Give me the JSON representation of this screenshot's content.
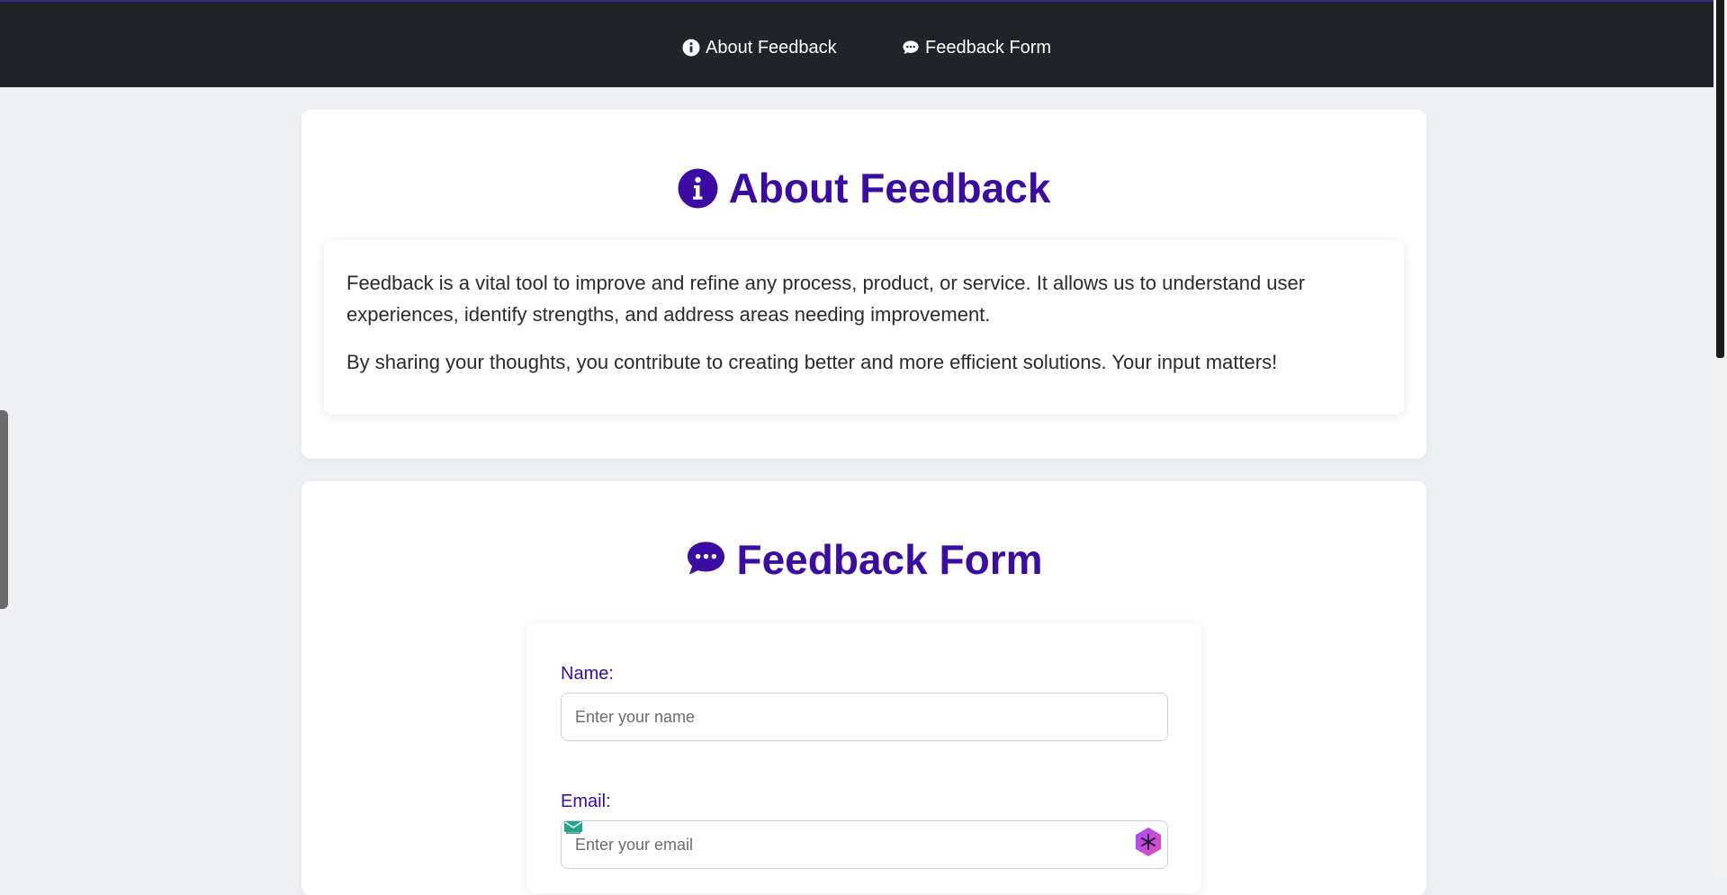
{
  "nav": {
    "about_label": "About Feedback",
    "form_label": "Feedback Form"
  },
  "about": {
    "title": "About Feedback",
    "paragraph1": "Feedback is a vital tool to improve and refine any process, product, or service. It allows us to understand user experiences, identify strengths, and address areas needing improvement.",
    "paragraph2": "By sharing your thoughts, you contribute to creating better and more efficient solutions. Your input matters!"
  },
  "form": {
    "title": "Feedback Form",
    "name_label": "Name:",
    "name_placeholder": "Enter your name",
    "name_value": "",
    "email_label": "Email:",
    "email_placeholder": "Enter your email",
    "email_value": ""
  },
  "icons": {
    "about": "info-circle-icon",
    "form": "comment-dots-icon",
    "email_autofill": "email-badge-icon",
    "extension": "hexagon-extension-icon"
  },
  "colors": {
    "accent": "#3a0ca3",
    "navbar": "#212429",
    "page_background": "#eef0f3"
  }
}
